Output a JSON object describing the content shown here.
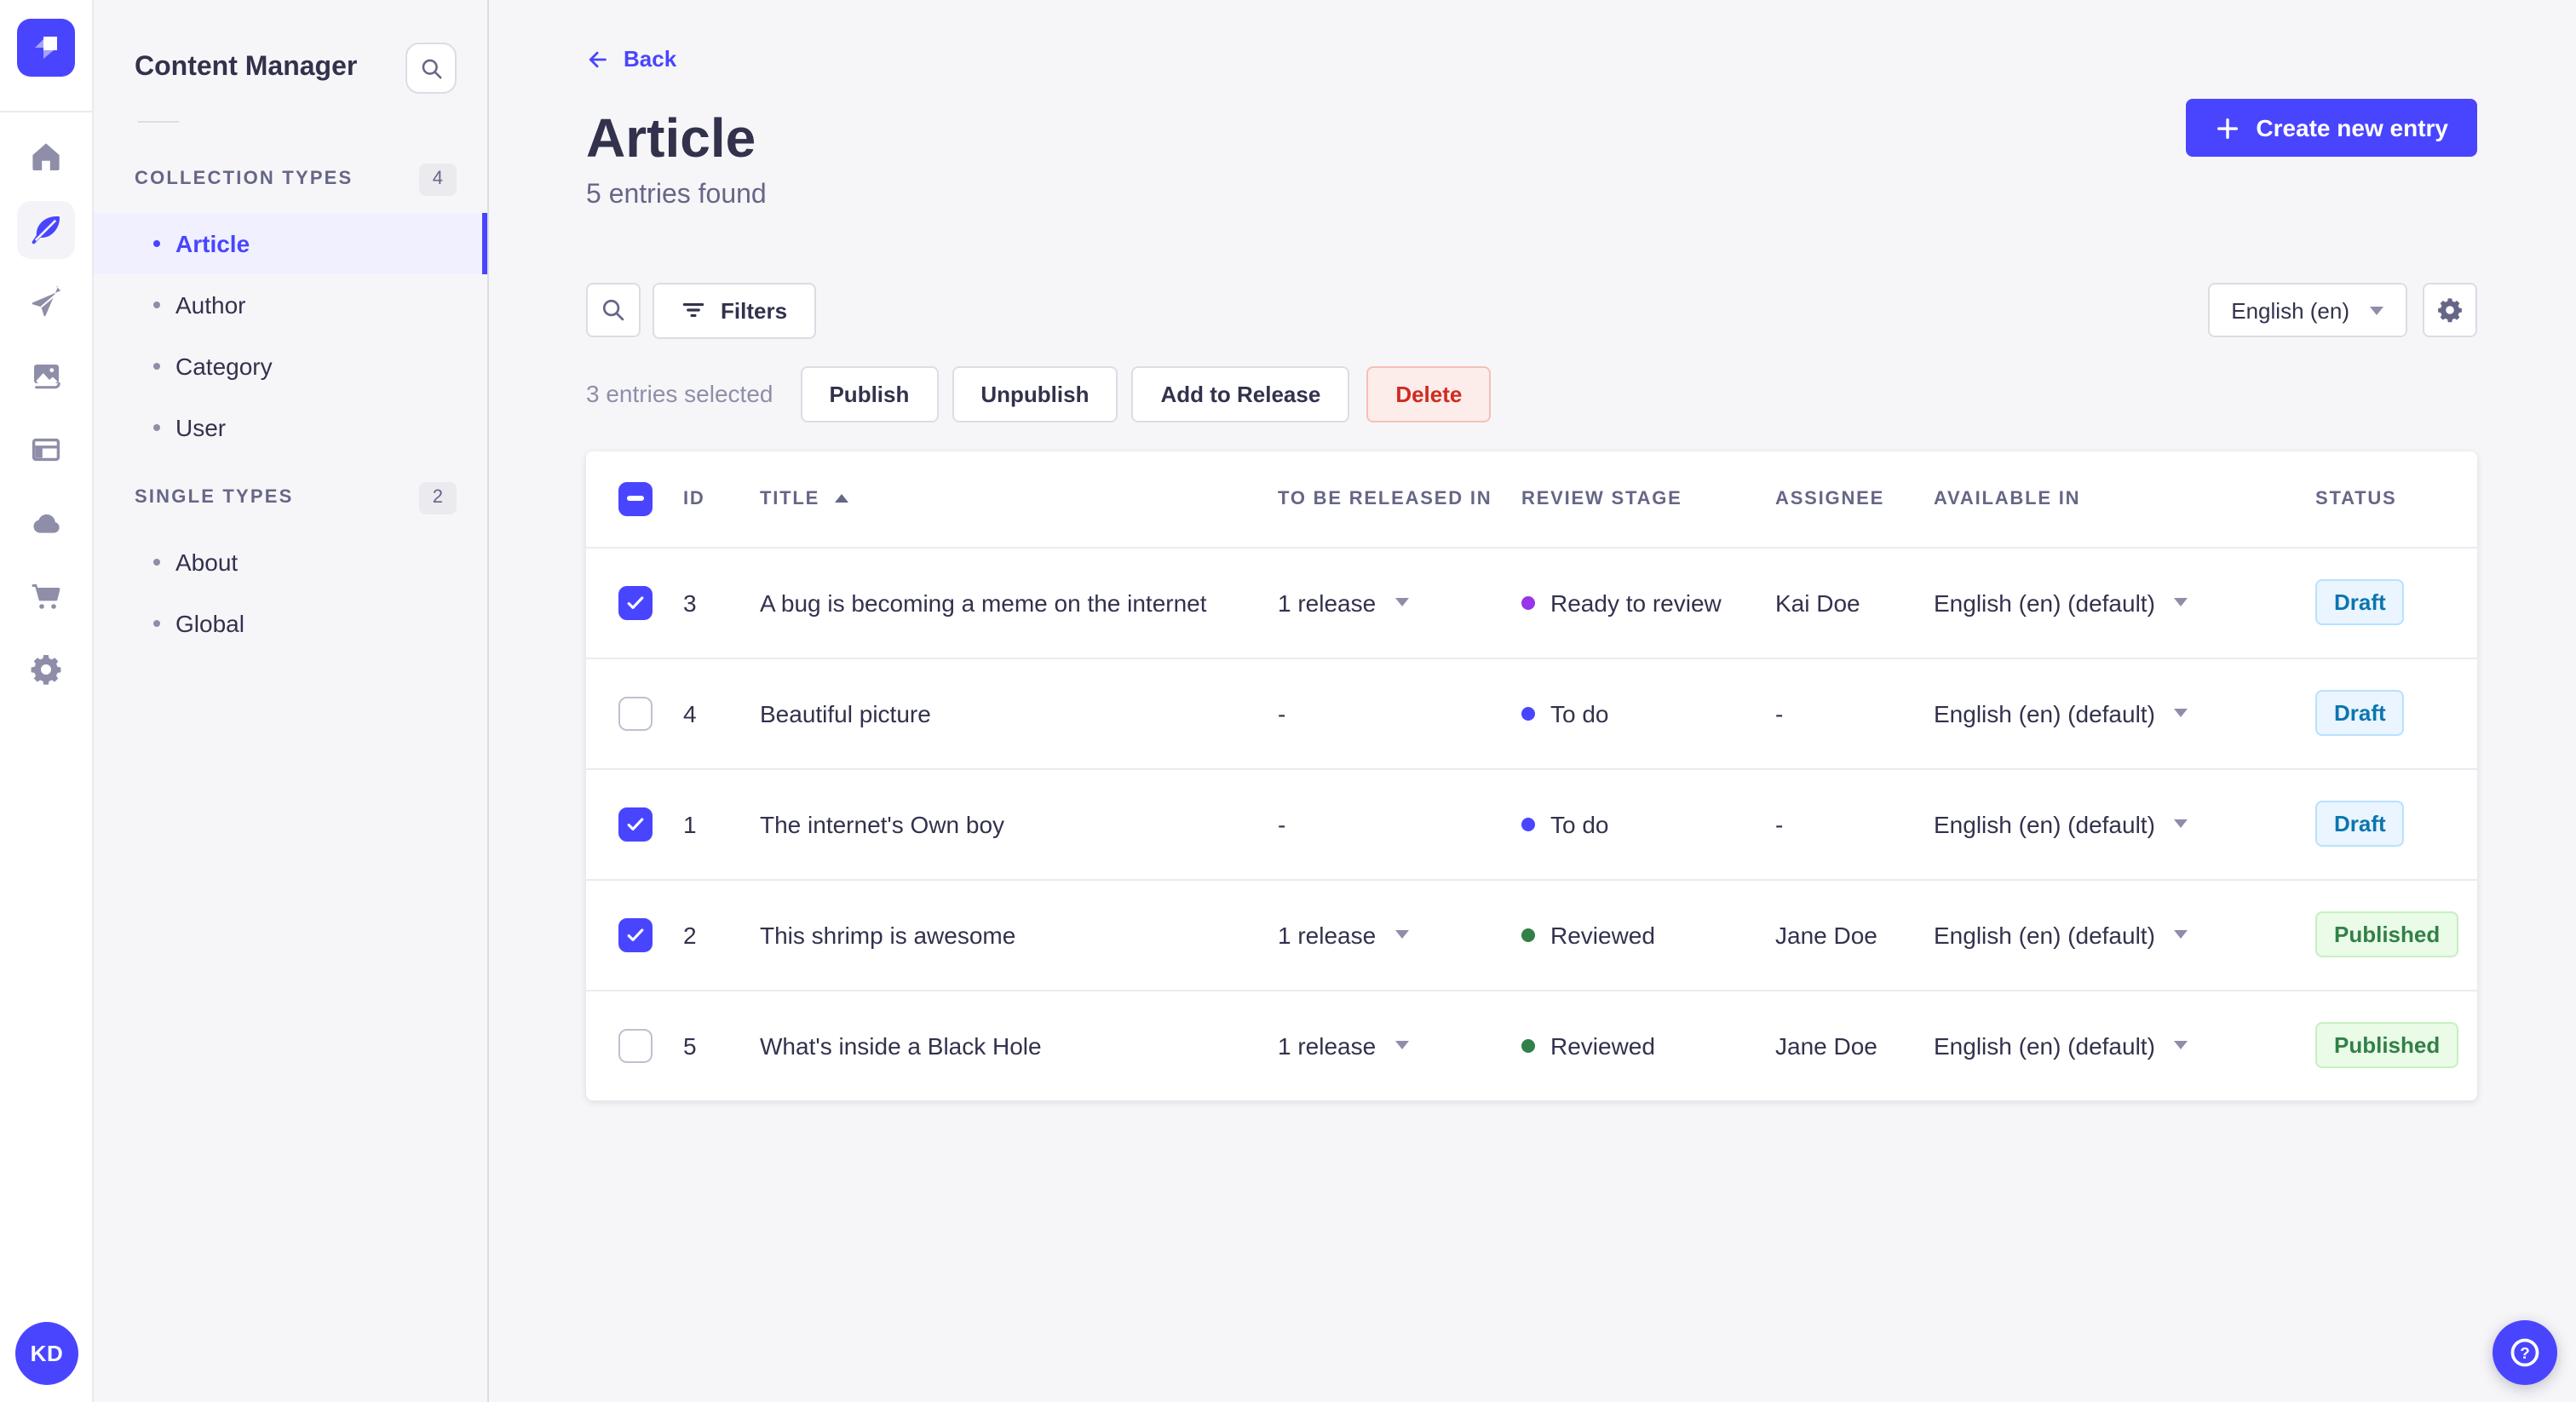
{
  "colors": {
    "primary": "#4945ff",
    "primary_light": "#f0f0ff",
    "danger_text": "#d02b20",
    "danger_bg": "#fcecea",
    "draft_text": "#0c75af",
    "draft_bg": "#eaf5ff",
    "published_text": "#328048",
    "published_bg": "#eafbe7",
    "stage_dots": {
      "purple": "#9736e8",
      "blue": "#4945ff",
      "green": "#328048"
    }
  },
  "main_nav": {
    "logo_icon": "strapi-logo",
    "icons": [
      "home-icon",
      "feather-icon",
      "paper-plane-icon",
      "media-images-icon",
      "layout-icon",
      "cloud-icon",
      "cart-icon",
      "gear-icon"
    ],
    "active_icon": "feather-icon",
    "avatar_initials": "KD"
  },
  "subnav": {
    "title": "Content Manager",
    "search_icon": "search-icon",
    "sections": [
      {
        "label": "COLLECTION TYPES",
        "badge": "4",
        "items": [
          {
            "label": "Article",
            "active": true
          },
          {
            "label": "Author"
          },
          {
            "label": "Category"
          },
          {
            "label": "User"
          }
        ]
      },
      {
        "label": "SINGLE TYPES",
        "badge": "2",
        "items": [
          {
            "label": "About"
          },
          {
            "label": "Global"
          }
        ]
      }
    ]
  },
  "header": {
    "back_label": "Back",
    "title": "Article",
    "subtitle": "5 entries found",
    "create_button_label": "Create new entry"
  },
  "toolbar": {
    "search_icon": "search-icon",
    "filters_label": "Filters",
    "locale_selector_value": "English (en)",
    "settings_icon": "gear-icon"
  },
  "selection_bar": {
    "text": "3 entries selected",
    "publish_label": "Publish",
    "unpublish_label": "Unpublish",
    "add_to_release_label": "Add to Release",
    "delete_label": "Delete"
  },
  "table": {
    "select_all_state": "indeterminate",
    "columns": [
      "ID",
      "TITLE",
      "TO BE RELEASED IN",
      "REVIEW STAGE",
      "ASSIGNEE",
      "AVAILABLE IN",
      "STATUS"
    ],
    "sort_column": "TITLE",
    "sort_direction": "ascending",
    "rows": [
      {
        "checked": true,
        "id": "3",
        "title": "A bug is becoming a meme on the internet",
        "release": "1 release",
        "has_release": true,
        "stage": "Ready to review",
        "stage_dot": "purple",
        "assignee": "Kai Doe",
        "locale": "English (en) (default)",
        "status": "Draft"
      },
      {
        "checked": false,
        "id": "4",
        "title": "Beautiful picture",
        "release": "-",
        "has_release": false,
        "stage": "To do",
        "stage_dot": "blue",
        "assignee": "-",
        "locale": "English (en) (default)",
        "status": "Draft"
      },
      {
        "checked": true,
        "id": "1",
        "title": "The internet's Own boy",
        "release": "-",
        "has_release": false,
        "stage": "To do",
        "stage_dot": "blue",
        "assignee": "-",
        "locale": "English (en) (default)",
        "status": "Draft"
      },
      {
        "checked": true,
        "id": "2",
        "title": "This shrimp is awesome",
        "release": "1 release",
        "has_release": true,
        "stage": "Reviewed",
        "stage_dot": "green",
        "assignee": "Jane Doe",
        "locale": "English (en) (default)",
        "status": "Published"
      },
      {
        "checked": false,
        "id": "5",
        "title": "What's inside a Black Hole",
        "release": "1 release",
        "has_release": true,
        "stage": "Reviewed",
        "stage_dot": "green",
        "assignee": "Jane Doe",
        "locale": "English (en) (default)",
        "status": "Published"
      }
    ]
  },
  "floating": {
    "help_icon": "question-mark-icon"
  }
}
